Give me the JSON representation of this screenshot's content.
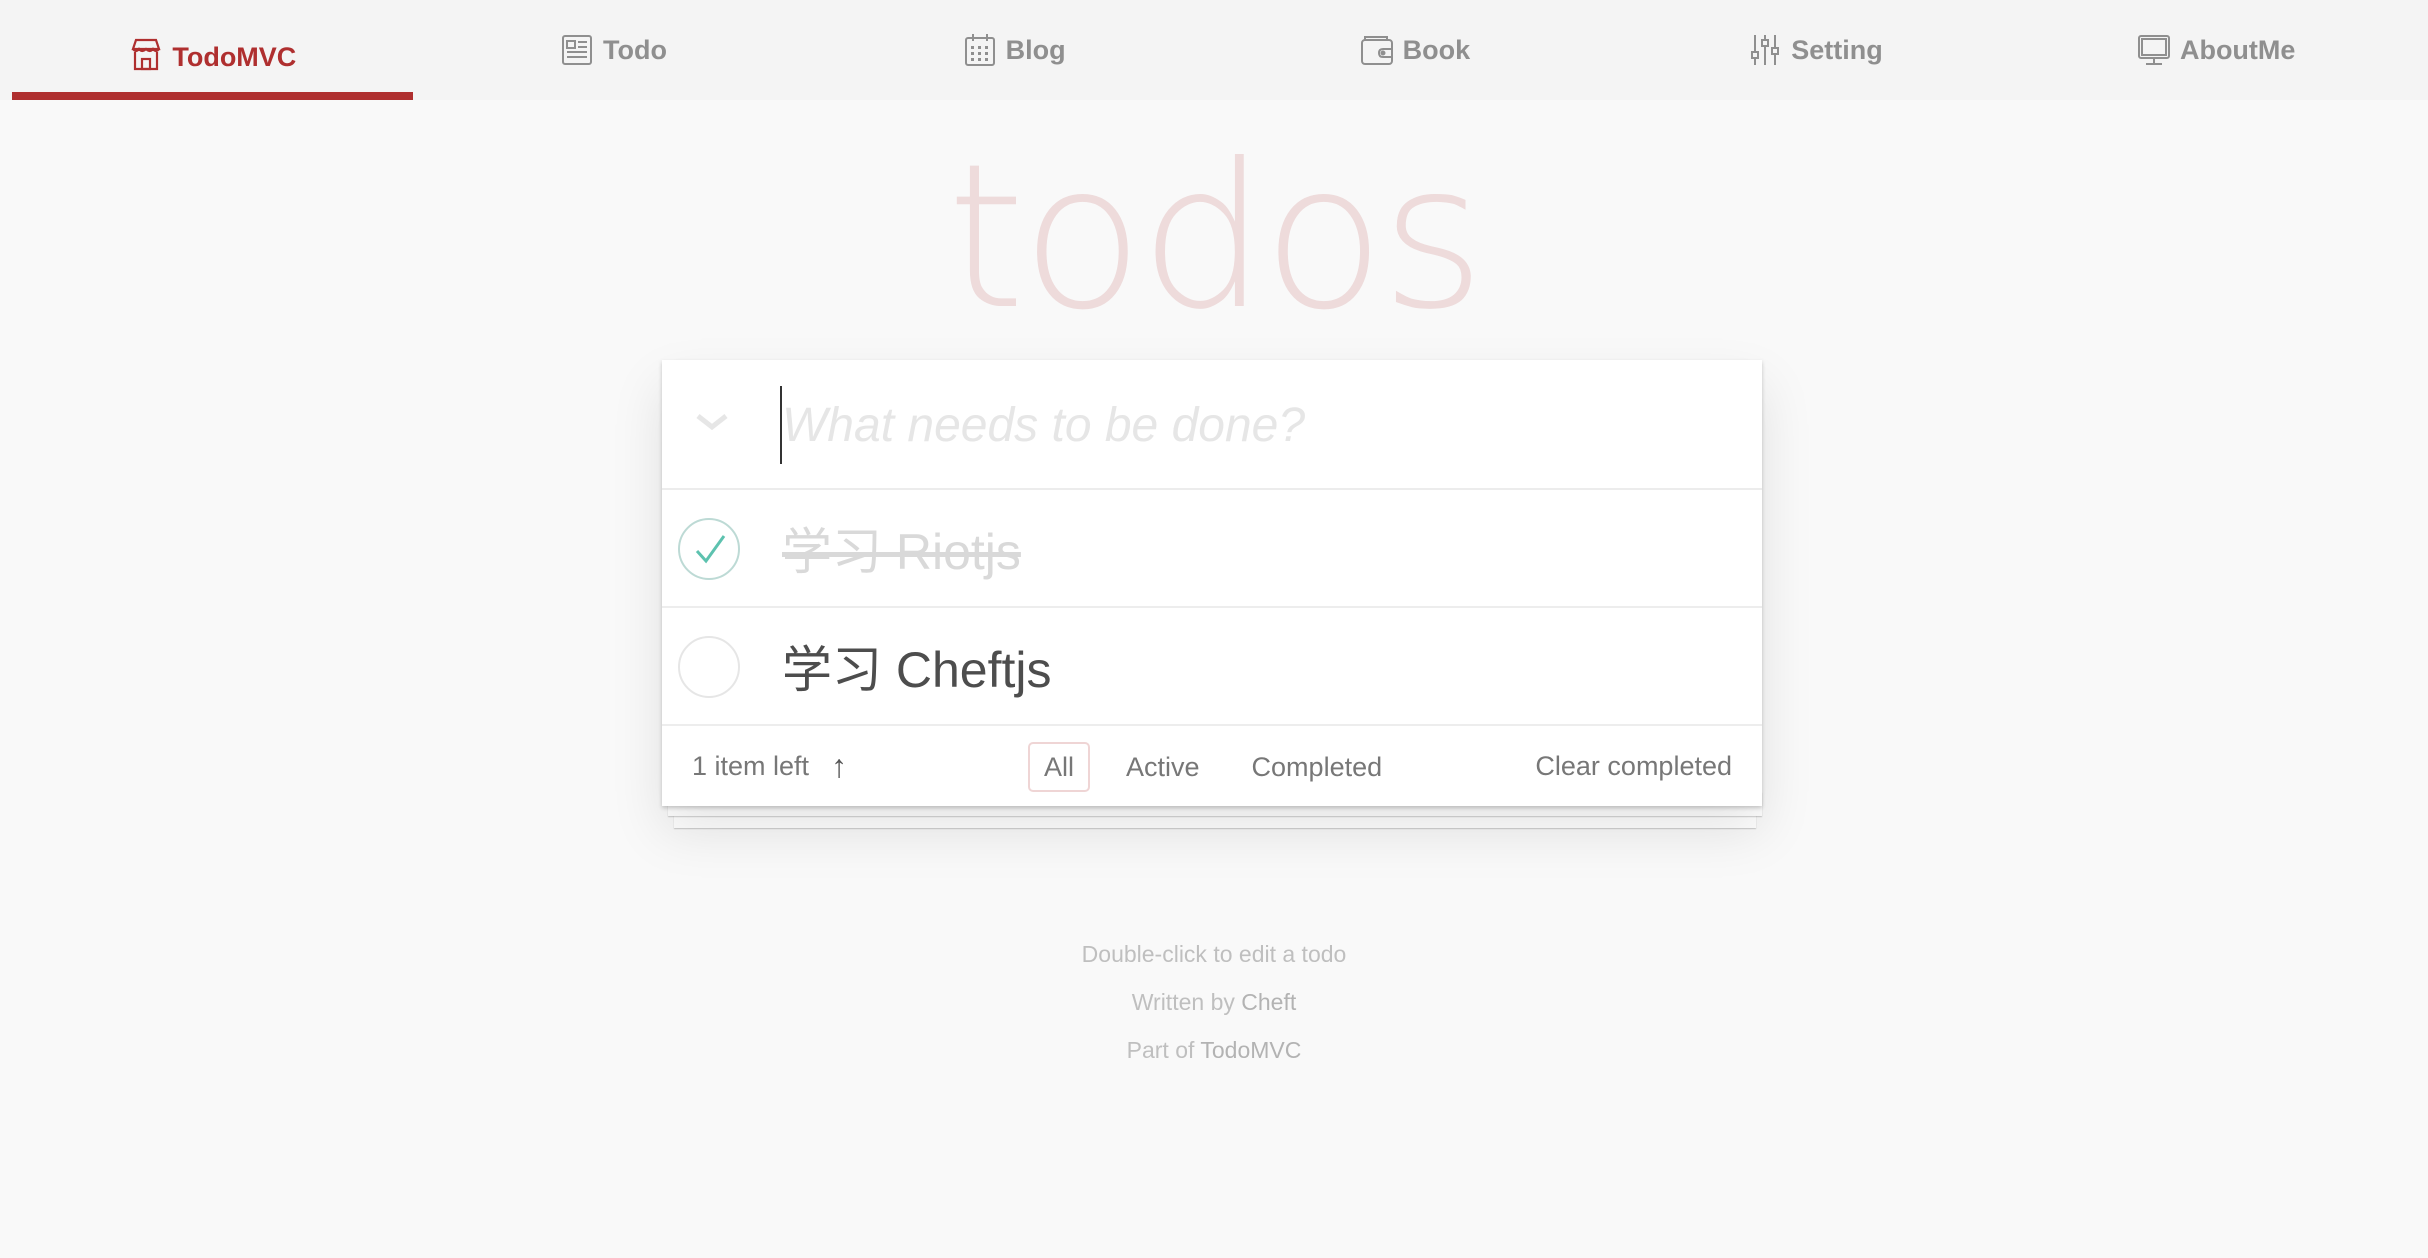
{
  "nav": {
    "items": [
      {
        "label": "TodoMVC",
        "icon": "store-icon",
        "active": true
      },
      {
        "label": "Todo",
        "icon": "document-icon",
        "active": false
      },
      {
        "label": "Blog",
        "icon": "calendar-icon",
        "active": false
      },
      {
        "label": "Book",
        "icon": "wallet-icon",
        "active": false
      },
      {
        "label": "Setting",
        "icon": "sliders-icon",
        "active": false
      },
      {
        "label": "AboutMe",
        "icon": "monitor-icon",
        "active": false
      }
    ],
    "active_color": "#af2f2f"
  },
  "app": {
    "title": "todos",
    "new_todo_placeholder": "What needs to be done?",
    "todos": [
      {
        "label": "学习 Riotjs",
        "completed": true
      },
      {
        "label": "学习 Cheftjs",
        "completed": false
      }
    ],
    "footer": {
      "count_text": "1 item left",
      "toggle_arrow": "↑",
      "filters": [
        {
          "label": "All",
          "selected": true
        },
        {
          "label": "Active",
          "selected": false
        },
        {
          "label": "Completed",
          "selected": false
        }
      ],
      "clear_completed": "Clear completed"
    }
  },
  "info": {
    "hint": "Double-click to edit a todo",
    "written_prefix": "Written by ",
    "author": "Cheft",
    "part_prefix": "Part of ",
    "part_link": "TodoMVC"
  }
}
